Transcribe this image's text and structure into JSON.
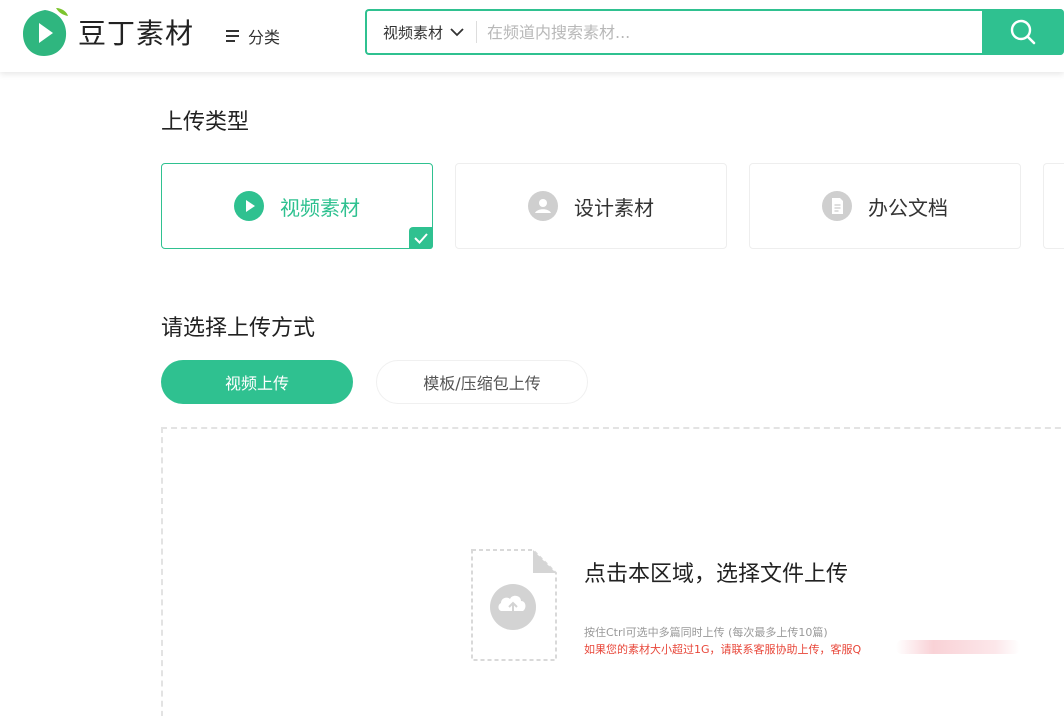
{
  "header": {
    "logo_text": "豆丁素材",
    "category_label": "分类",
    "search": {
      "channel_label": "视频素材",
      "placeholder": "在频道内搜索素材..."
    }
  },
  "upload_type": {
    "title": "上传类型",
    "options": [
      {
        "label": "视频素材",
        "selected": true
      },
      {
        "label": "设计素材",
        "selected": false
      },
      {
        "label": "办公文档",
        "selected": false
      }
    ]
  },
  "upload_method": {
    "title": "请选择上传方式",
    "tabs": [
      {
        "label": "视频上传",
        "active": true
      },
      {
        "label": "模板/压缩包上传",
        "active": false
      }
    ]
  },
  "dropzone": {
    "title": "点击本区域，选择文件上传",
    "hint": "按住Ctrl可选中多篇同时上传 (每次最多上传10篇)",
    "warning": "如果您的素材大小超过1G，请联系客服协助上传，客服Q"
  },
  "colors": {
    "accent": "#2fc190",
    "warning": "#e8473a"
  }
}
